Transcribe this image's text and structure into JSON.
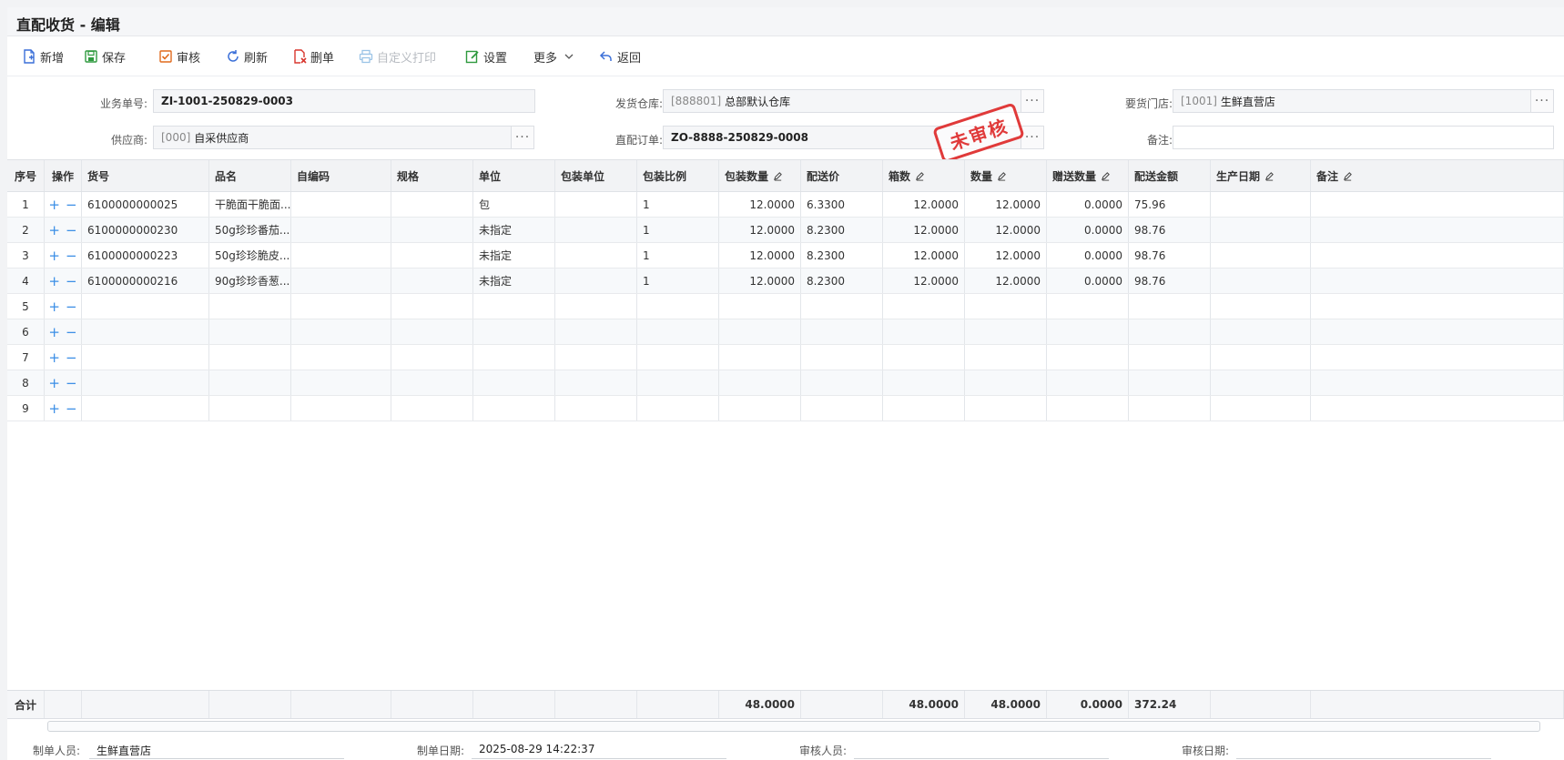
{
  "window": {
    "title": "直配收货 - 编辑"
  },
  "toolbar": {
    "new_label": "新增",
    "save_label": "保存",
    "audit_label": "审核",
    "refresh_label": "刷新",
    "delete_label": "删单",
    "print_label": "自定义打印",
    "settings_label": "设置",
    "more_label": "更多",
    "back_label": "返回"
  },
  "form": {
    "biz_no_label": "业务单号:",
    "biz_no_value": "ZI-1001-250829-0003",
    "warehouse_label": "发货仓库:",
    "warehouse_code": "[888801]",
    "warehouse_name": "总部默认仓库",
    "store_label": "要货门店:",
    "store_code": "[1001]",
    "store_name": "生鲜直营店",
    "supplier_label": "供应商:",
    "supplier_code": "[000]",
    "supplier_name": "自采供应商",
    "order_label": "直配订单:",
    "order_value": "ZO-8888-250829-0008",
    "remark_label": "备注:",
    "remark_value": "",
    "stamp_text": "未审核"
  },
  "grid": {
    "headers": [
      "序号",
      "操作",
      "货号",
      "品名",
      "自编码",
      "规格",
      "单位",
      "包装单位",
      "包装比例",
      "包装数量",
      "配送价",
      "箱数",
      "数量",
      "赠送数量",
      "配送金额",
      "生产日期",
      "备注"
    ],
    "rows": [
      [
        "1",
        "",
        "6100000000025",
        "干脆面干脆面...",
        "",
        "",
        "包",
        "",
        "1",
        "12.0000",
        "6.3300",
        "12.0000",
        "12.0000",
        "0.0000",
        "75.96",
        "",
        ""
      ],
      [
        "2",
        "",
        "6100000000230",
        "50g珍珍番茄...",
        "",
        "",
        "未指定",
        "",
        "1",
        "12.0000",
        "8.2300",
        "12.0000",
        "12.0000",
        "0.0000",
        "98.76",
        "",
        ""
      ],
      [
        "3",
        "",
        "6100000000223",
        "50g珍珍脆皮...",
        "",
        "",
        "未指定",
        "",
        "1",
        "12.0000",
        "8.2300",
        "12.0000",
        "12.0000",
        "0.0000",
        "98.76",
        "",
        ""
      ],
      [
        "4",
        "",
        "6100000000216",
        "90g珍珍香葱...",
        "",
        "",
        "未指定",
        "",
        "1",
        "12.0000",
        "8.2300",
        "12.0000",
        "12.0000",
        "0.0000",
        "98.76",
        "",
        ""
      ],
      [
        "5",
        "",
        "",
        "",
        "",
        "",
        "",
        "",
        "",
        "",
        "",
        "",
        "",
        "",
        "",
        "",
        ""
      ],
      [
        "6",
        "",
        "",
        "",
        "",
        "",
        "",
        "",
        "",
        "",
        "",
        "",
        "",
        "",
        "",
        "",
        ""
      ],
      [
        "7",
        "",
        "",
        "",
        "",
        "",
        "",
        "",
        "",
        "",
        "",
        "",
        "",
        "",
        "",
        "",
        ""
      ],
      [
        "8",
        "",
        "",
        "",
        "",
        "",
        "",
        "",
        "",
        "",
        "",
        "",
        "",
        "",
        "",
        "",
        ""
      ],
      [
        "9",
        "",
        "",
        "",
        "",
        "",
        "",
        "",
        "",
        "",
        "",
        "",
        "",
        "",
        "",
        "",
        ""
      ]
    ],
    "op_plus": "+",
    "op_minus": "−",
    "summary": {
      "label": "合计",
      "pack_qty": "48.0000",
      "boxes": "48.0000",
      "qty": "48.0000",
      "gift_qty": "0.0000",
      "amount": "372.24"
    }
  },
  "footer": {
    "creator_label": "制单人员:",
    "creator_value": "生鲜直营店",
    "create_date_label": "制单日期:",
    "create_date_value": "2025-08-29 14:22:37",
    "auditor_label": "审核人员:",
    "auditor_value": "",
    "audit_date_label": "审核日期:",
    "audit_date_value": ""
  },
  "colors": {
    "accent": "#3a8ee6",
    "stamp": "#e03a3a"
  }
}
